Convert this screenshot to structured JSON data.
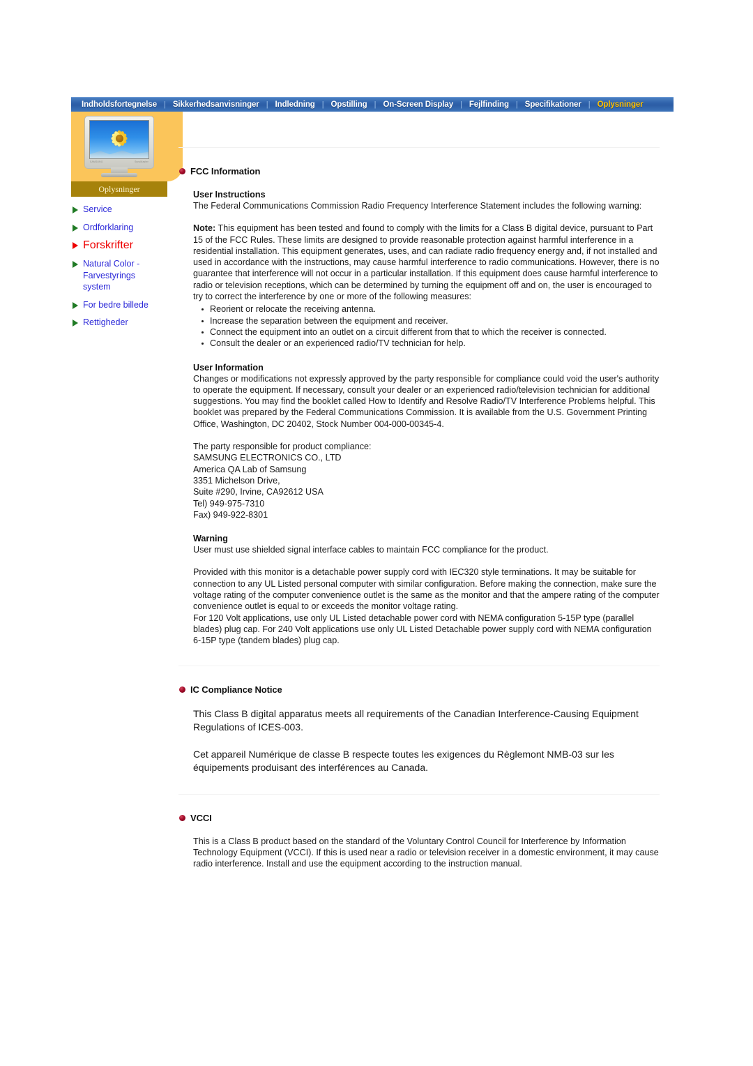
{
  "nav": {
    "items": [
      {
        "label": "Indholdsfortegnelse",
        "active": false
      },
      {
        "label": "Sikkerhedsanvisninger",
        "active": false
      },
      {
        "label": "Indledning",
        "active": false
      },
      {
        "label": "Opstilling",
        "active": false
      },
      {
        "label": "On-Screen Display",
        "active": false
      },
      {
        "label": "Fejlfinding",
        "active": false
      },
      {
        "label": "Specifikationer",
        "active": false
      },
      {
        "label": "Oplysninger",
        "active": true
      }
    ],
    "separator": "|",
    "active_color": "#ffc000",
    "bar_color": "#2f62ab"
  },
  "sidebar": {
    "thumbnail_caption": "Oplysninger",
    "monitor_brand_left": "SAMSUNG",
    "monitor_brand_right": "SyncMaster",
    "links": [
      {
        "label": "Service",
        "current": false
      },
      {
        "label": "Ordforklaring",
        "current": false
      },
      {
        "label": "Forskrifter",
        "current": true
      },
      {
        "label": "Natural Color - Farvestyrings system",
        "current": false
      },
      {
        "label": "For bedre billede",
        "current": false
      },
      {
        "label": "Rettigheder",
        "current": false
      }
    ],
    "link_color": "#2b28d8",
    "current_color": "#ee0000",
    "arrow_color": "#1f7a24",
    "panel_color": "#fbc55a",
    "caption_color": "#a6820b"
  },
  "main": {
    "fcc": {
      "title": "FCC Information",
      "user_instructions_head": "User Instructions",
      "user_instructions_body": "The Federal Communications Commission Radio Frequency Interference Statement includes the following warning:",
      "note_label": "Note:",
      "note_body": " This equipment has been tested and found to comply with the limits for a Class B digital device, pursuant to Part 15 of the FCC Rules. These limits are designed to provide reasonable protection against harmful interference in a residential installation. This equipment generates, uses, and can radiate radio frequency energy and, if not installed and used in accordance with the instructions, may cause harmful interference to radio communications. However, there is no guarantee that interference will not occur in a particular installation. If this equipment does cause harmful interference to radio or television receptions, which can be determined by turning the equipment off and on, the user is encouraged to try to correct the interference by one or more of the following measures:",
      "measures": [
        "Reorient or relocate the receiving antenna.",
        "Increase the separation between the equipment and receiver.",
        "Connect the equipment into an outlet on a circuit different from that to which the receiver is connected.",
        "Consult the dealer or an experienced radio/TV technician for help."
      ],
      "user_information_head": "User Information",
      "user_information_body": "Changes or modifications not expressly approved by the party responsible for compliance could void the user's authority to operate the equipment. If necessary, consult your dealer or an experienced radio/television technician for additional suggestions. You may find the booklet called How to Identify and Resolve Radio/TV Interference Problems helpful. This booklet was prepared by the Federal Communications Commission. It is available from the U.S. Government Printing Office, Washington, DC 20402, Stock Number 004-000-00345-4.",
      "address": [
        "The party responsible for product compliance:",
        "SAMSUNG ELECTRONICS CO., LTD",
        "America QA Lab of Samsung",
        "3351 Michelson Drive,",
        "Suite #290, Irvine, CA92612 USA",
        "Tel) 949-975-7310",
        "Fax) 949-922-8301"
      ],
      "warning_head": "Warning",
      "warning_body": "User must use shielded signal interface cables to maintain FCC compliance for the product.",
      "power_cord_body": "Provided with this monitor is a detachable power supply cord with IEC320 style terminations. It may be suitable for connection to any UL Listed personal computer with similar configuration. Before making the connection, make sure the voltage rating of the computer convenience outlet is the same as the monitor and that the ampere rating of the computer convenience outlet is equal to or exceeds the monitor voltage rating.",
      "power_cord_body2": "For 120 Volt applications, use only UL Listed detachable power cord with NEMA configuration 5-15P type (parallel blades) plug cap. For 240 Volt applications use only UL Listed Detachable power supply cord with NEMA configuration 6-15P type (tandem blades) plug cap."
    },
    "ic": {
      "title": "IC Compliance Notice",
      "paragraph_en": "This Class B digital apparatus meets all requirements of the Canadian Interference-Causing Equipment Regulations of ICES-003.",
      "paragraph_fr": "Cet appareil Numérique de classe B respecte toutes les exigences du Règlemont NMB-03 sur les équipements produisant des interférences au Canada."
    },
    "vcci": {
      "title": "VCCI",
      "paragraph": "This is a Class B product based on the standard of the Voluntary Control Council for Interference by Information Technology Equipment (VCCI). If this is used near a radio or television receiver in a domestic environment, it may cause radio interference. Install and use the equipment according to the instruction manual."
    }
  }
}
